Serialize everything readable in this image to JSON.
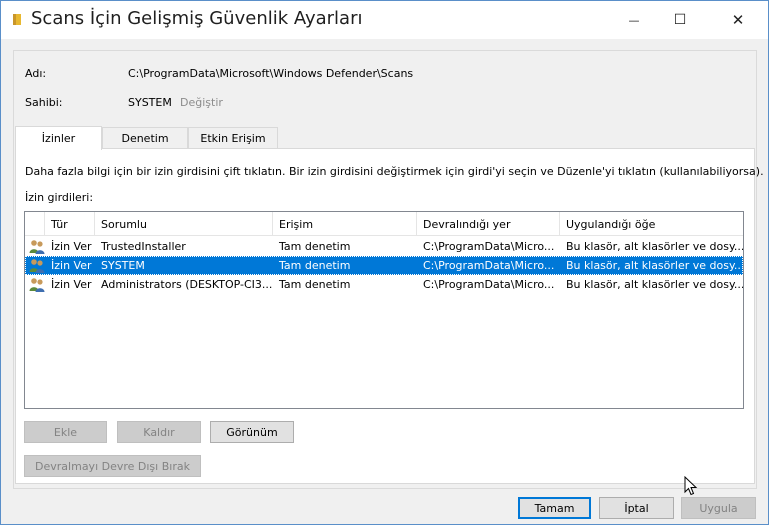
{
  "window": {
    "title": "Scans İçin Gelişmiş Güvenlik Ayarları",
    "min_glyph": "—",
    "max_glyph": "☐",
    "close_glyph": "✕"
  },
  "info": {
    "name_label": "Adı:",
    "name_value": "C:\\ProgramData\\Microsoft\\Windows Defender\\Scans",
    "owner_label": "Sahibi:",
    "owner_value": "SYSTEM",
    "owner_change_link": "Değiştir"
  },
  "tabs": [
    {
      "label": "İzinler",
      "active": true
    },
    {
      "label": "Denetim",
      "active": false
    },
    {
      "label": "Etkin Erişim",
      "active": false
    }
  ],
  "panel": {
    "instructions": "Daha fazla bilgi için bir izin girdisini çift tıklatın. Bir izin girdisini değiştirmek için girdi'yi seçin ve Düzenle'yi tıklatın (kullanılabiliyorsa).",
    "entries_label": "İzin girdileri:"
  },
  "table": {
    "columns": [
      "Tür",
      "Sorumlu",
      "Erişim",
      "Devralındığı yer",
      "Uygulandığı öğe"
    ],
    "rows": [
      {
        "type": "İzin Ver",
        "principal": "TrustedInstaller",
        "access": "Tam denetim",
        "inherited": "C:\\ProgramData\\Micro...",
        "applies": "Bu klasör, alt klasörler ve dosy...",
        "selected": false
      },
      {
        "type": "İzin Ver",
        "principal": "SYSTEM",
        "access": "Tam denetim",
        "inherited": "C:\\ProgramData\\Micro...",
        "applies": "Bu klasör, alt klasörler ve dosy...",
        "selected": true
      },
      {
        "type": "İzin Ver",
        "principal": "Administrators (DESKTOP-CI3...",
        "access": "Tam denetim",
        "inherited": "C:\\ProgramData\\Micro...",
        "applies": "Bu klasör, alt klasörler ve dosy...",
        "selected": false
      }
    ]
  },
  "buttons": {
    "add": "Ekle",
    "remove": "Kaldır",
    "view": "Görünüm",
    "disable_inheritance": "Devralmayı Devre Dışı Bırak",
    "ok": "Tamam",
    "cancel": "İptal",
    "apply": "Uygula"
  },
  "colors": {
    "accent": "#0078d7",
    "selection": "#0078d7",
    "border": "#5a8fc9",
    "disabled_text": "#838383"
  },
  "icons": {
    "title": "folder-lock-icon",
    "row": "user-group-icon"
  }
}
